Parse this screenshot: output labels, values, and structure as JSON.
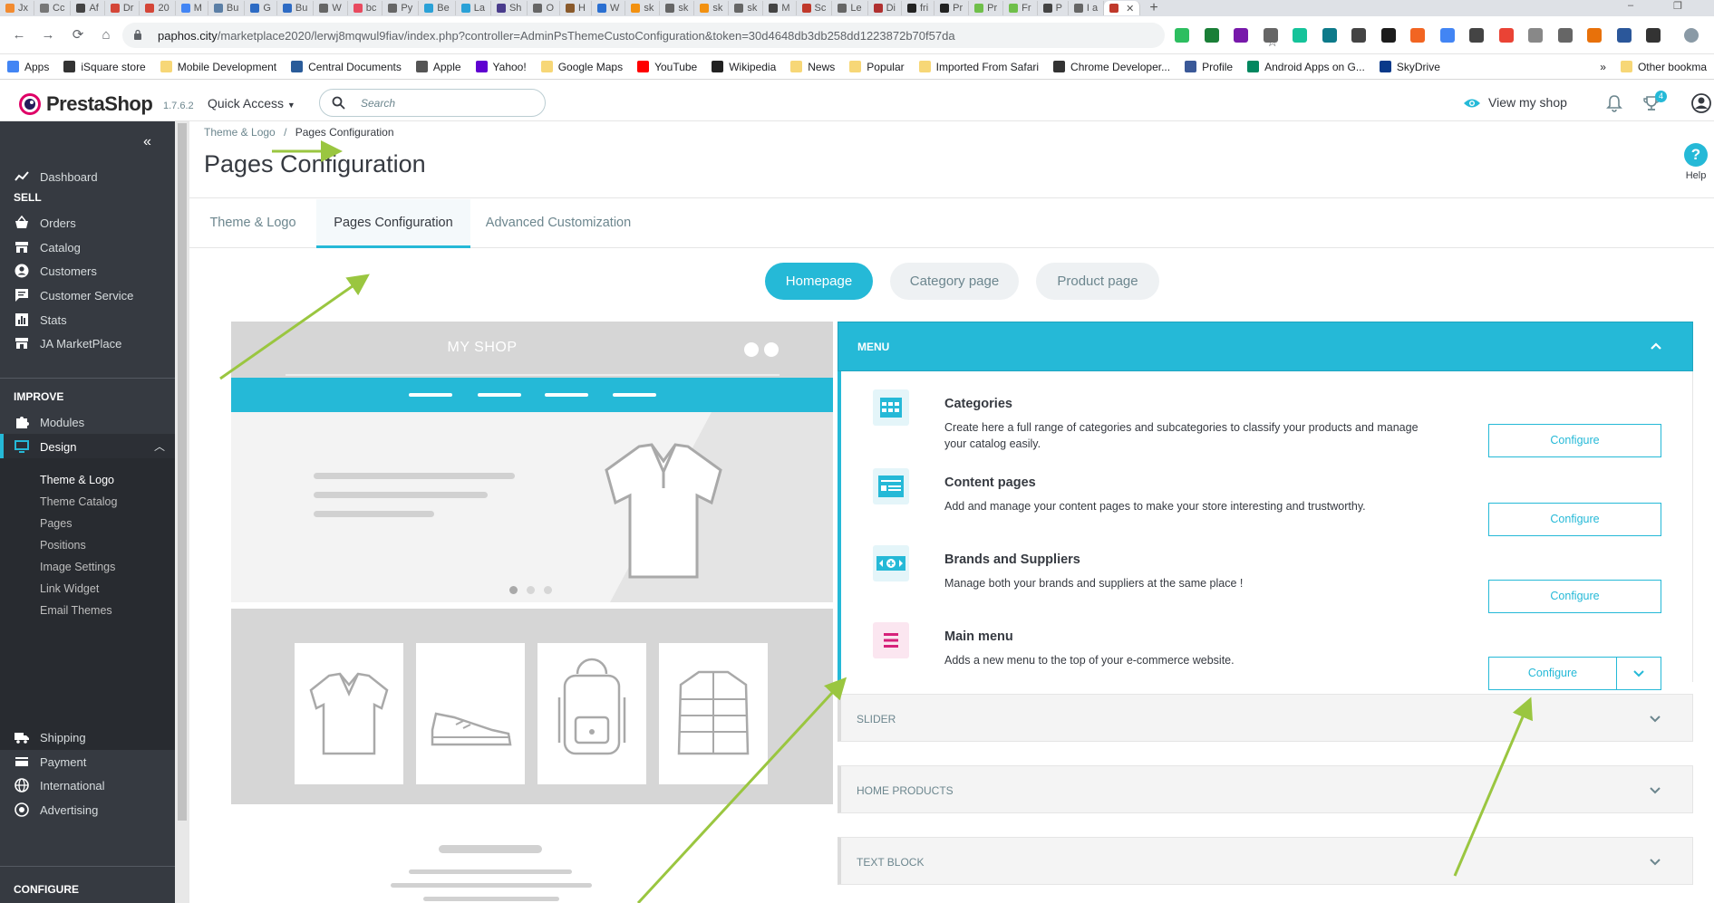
{
  "browser": {
    "tabs": [
      {
        "label": "Jx",
        "color": "#f28b30"
      },
      {
        "label": "Cc",
        "color": "#777777"
      },
      {
        "label": "Af",
        "color": "#444444"
      },
      {
        "label": "Dr",
        "color": "#d44638"
      },
      {
        "label": "20",
        "color": "#d44638"
      },
      {
        "label": "M",
        "color": "#4285f4"
      },
      {
        "label": "Bu",
        "color": "#5b7fa6"
      },
      {
        "label": "G",
        "color": "#2d6bc4"
      },
      {
        "label": "Bu",
        "color": "#2d6bc4"
      },
      {
        "label": "W",
        "color": "#666666"
      },
      {
        "label": "bc",
        "color": "#e84a5f"
      },
      {
        "label": "Py",
        "color": "#666666"
      },
      {
        "label": "Be",
        "color": "#2aa1d7"
      },
      {
        "label": "La",
        "color": "#2aa1d7"
      },
      {
        "label": "Sh",
        "color": "#4a3c8c"
      },
      {
        "label": "O",
        "color": "#666666"
      },
      {
        "label": "H",
        "color": "#8a5a2b"
      },
      {
        "label": "W",
        "color": "#2a6fd1"
      },
      {
        "label": "sk",
        "color": "#f29111"
      },
      {
        "label": "sk",
        "color": "#666666"
      },
      {
        "label": "sk",
        "color": "#f29111"
      },
      {
        "label": "sk",
        "color": "#666666"
      },
      {
        "label": "M",
        "color": "#444444"
      },
      {
        "label": "Sc",
        "color": "#c0392b"
      },
      {
        "label": "Le",
        "color": "#666666"
      },
      {
        "label": "Di",
        "color": "#b03030"
      },
      {
        "label": "fri",
        "color": "#222222"
      },
      {
        "label": "Pr",
        "color": "#222222"
      },
      {
        "label": "Pr",
        "color": "#6fbf4a"
      },
      {
        "label": "Fr",
        "color": "#6fbf4a"
      },
      {
        "label": "P",
        "color": "#444444"
      },
      {
        "label": "I a",
        "color": "#666666"
      },
      {
        "label": "",
        "color": "#c0392b",
        "active": true
      }
    ],
    "new_tab": "+",
    "window_controls": {
      "minimize": "–",
      "restore": "❐"
    },
    "url_host": "paphos.city",
    "url_path": "/marketplace2020/lerwj8mqwul9fiav/index.php?controller=AdminPsThemeCustoConfiguration&token=30d4648db3db258dd1223872b70f57da",
    "bookmarks": [
      {
        "label": "Apps",
        "icon": "apps-icon",
        "color": "#4285f4"
      },
      {
        "label": "iSquare store",
        "icon": "info-icon",
        "color": "#333333"
      },
      {
        "label": "Mobile Development",
        "icon": "folder-icon",
        "color": "#f7d777"
      },
      {
        "label": "Central Documents",
        "icon": "document-icon",
        "color": "#2a5c9a"
      },
      {
        "label": "Apple",
        "icon": "apple-icon",
        "color": "#555555"
      },
      {
        "label": "Yahoo!",
        "icon": "yahoo-icon",
        "color": "#5f01d1"
      },
      {
        "label": "Google Maps",
        "icon": "folder-icon",
        "color": "#f7d777"
      },
      {
        "label": "YouTube",
        "icon": "youtube-icon",
        "color": "#ff0000"
      },
      {
        "label": "Wikipedia",
        "icon": "wikipedia-icon",
        "color": "#222222"
      },
      {
        "label": "News",
        "icon": "folder-icon",
        "color": "#f7d777"
      },
      {
        "label": "Popular",
        "icon": "folder-icon",
        "color": "#f7d777"
      },
      {
        "label": "Imported From Safari",
        "icon": "folder-icon",
        "color": "#f7d777"
      },
      {
        "label": "Chrome Developer...",
        "icon": "chrome-icon",
        "color": "#333333"
      },
      {
        "label": "Profile",
        "icon": "facebook-icon",
        "color": "#3b5998"
      },
      {
        "label": "Android Apps on G...",
        "icon": "play-store-icon",
        "color": "#01875f"
      },
      {
        "label": "SkyDrive",
        "icon": "cloud-icon",
        "color": "#0a3a8a"
      }
    ],
    "bookmarks_more": "»",
    "other_bookmarks": "Other bookma"
  },
  "header": {
    "logo": "PrestaShop",
    "version": "1.7.6.2",
    "quick_access": "Quick Access",
    "search_placeholder": "Search",
    "view_shop": "View my shop",
    "notification_count": "4"
  },
  "sidebar": {
    "collapse": "«",
    "dashboard": "Dashboard",
    "sections": {
      "sell": "SELL",
      "improve": "IMPROVE",
      "configure": "CONFIGURE"
    },
    "sell_items": [
      "Orders",
      "Catalog",
      "Customers",
      "Customer Service",
      "Stats",
      "JA MarketPlace"
    ],
    "improve_items": [
      "Modules",
      "Design"
    ],
    "design_sub": [
      "Theme & Logo",
      "Theme Catalog",
      "Pages",
      "Positions",
      "Image Settings",
      "Link Widget",
      "Email Themes"
    ],
    "other_items": [
      "Shipping",
      "Payment",
      "International",
      "Advertising"
    ]
  },
  "content": {
    "breadcrumb_parent": "Theme & Logo",
    "breadcrumb_sep": "/",
    "breadcrumb_current": "Pages Configuration",
    "title": "Pages Configuration",
    "help": "Help",
    "tabs": [
      "Theme & Logo",
      "Pages Configuration",
      "Advanced Customization"
    ],
    "page_pills": [
      "Homepage",
      "Category page",
      "Product page"
    ],
    "preview_shop": "MY SHOP"
  },
  "config": {
    "menu_title": "MENU",
    "modules": [
      {
        "title": "Categories",
        "desc": "Create here a full range of categories and subcategories to classify your products and manage your catalog easily.",
        "button": "Configure",
        "icon": "categories-icon"
      },
      {
        "title": "Content pages",
        "desc": "Add and manage your content pages to make your store interesting and trustworthy.",
        "button": "Configure",
        "icon": "content-pages-icon"
      },
      {
        "title": "Brands and Suppliers",
        "desc": "Manage both your brands and suppliers at the same place !",
        "button": "Configure",
        "icon": "brands-icon"
      },
      {
        "title": "Main menu",
        "desc": "Adds a new menu to the top of your e-commerce website.",
        "button": "Configure",
        "icon": "main-menu-icon"
      }
    ],
    "collapsed_sections": [
      "SLIDER",
      "HOME PRODUCTS",
      "TEXT BLOCK"
    ]
  },
  "colors": {
    "accent": "#25b9d7",
    "sidebar": "#363a41",
    "annotation": "#9ac640"
  }
}
